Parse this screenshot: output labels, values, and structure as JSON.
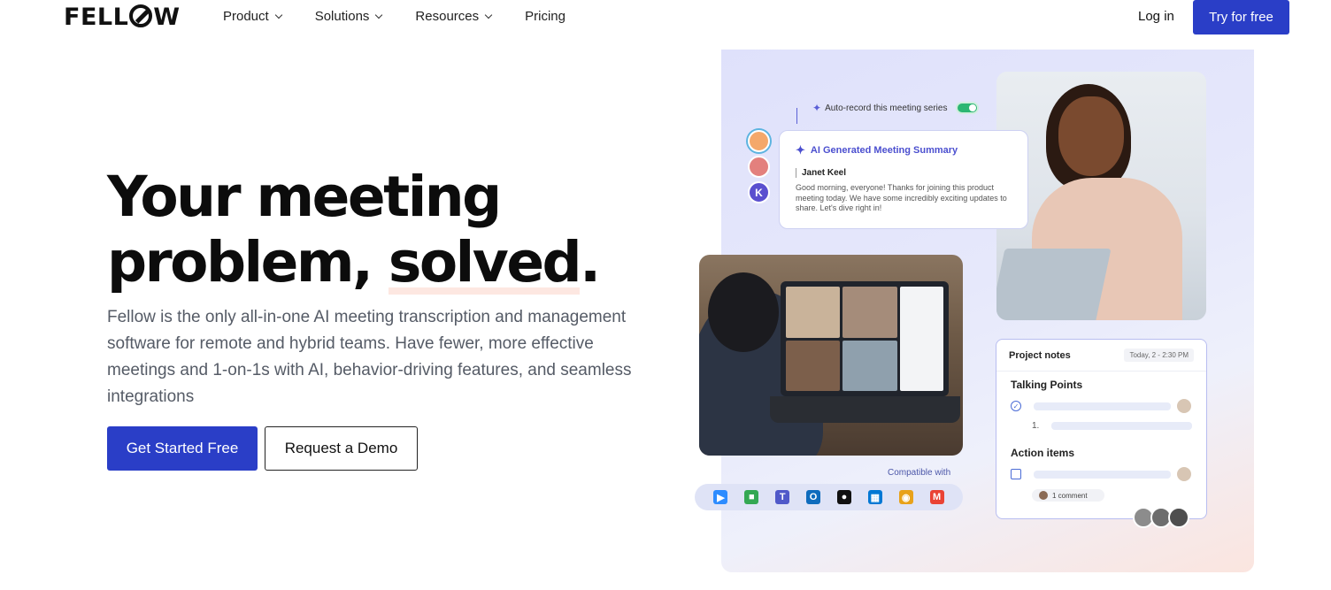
{
  "nav": {
    "logo": "FELL",
    "logo_tail": "W",
    "menu": [
      {
        "label": "Product",
        "has_dropdown": true
      },
      {
        "label": "Solutions",
        "has_dropdown": true
      },
      {
        "label": "Resources",
        "has_dropdown": true
      },
      {
        "label": "Pricing",
        "has_dropdown": false
      }
    ],
    "login": "Log in",
    "cta": "Try for free"
  },
  "hero": {
    "headline_line1": "Your meeting",
    "headline_line2_a": "problem, ",
    "headline_line2_highlight": "solved",
    "headline_line2_end": ".",
    "subtext": "Fellow is the only all-in-one AI meeting transcription and management software for remote and hybrid teams. Have fewer, more effective meetings and 1-on-1s with AI, behavior-driving features, and seamless integrations",
    "primary_button": "Get Started Free",
    "secondary_button": "Request a Demo"
  },
  "illustration": {
    "autorecord_label": "Auto-record this meeting series",
    "autorecord_on": true,
    "avatar_initial": "K",
    "ai_card": {
      "title": "AI Generated Meeting Summary",
      "speaker": "Janet Keel",
      "message": "Good morning, everyone! Thanks for joining this product meeting today. We have some incredibly exciting updates to share. Let's dive right in!"
    },
    "notes_card": {
      "title": "Project notes",
      "date": "Today, 2 - 2:30 PM",
      "section1": "Talking Points",
      "numbered_item": "1.",
      "section2": "Action items",
      "comment": "1 comment"
    },
    "compatible_label": "Compatible with",
    "integrations": [
      {
        "name": "zoom-icon",
        "glyph": "▶",
        "color": "#2d8cff"
      },
      {
        "name": "google-meet-icon",
        "glyph": "■",
        "color": "#34a853"
      },
      {
        "name": "teams-icon",
        "glyph": "T",
        "color": "#5059c9"
      },
      {
        "name": "outlook-icon",
        "glyph": "O",
        "color": "#0f6cbd"
      },
      {
        "name": "apple-icon",
        "glyph": "●",
        "color": "#111111"
      },
      {
        "name": "windows-icon",
        "glyph": "▦",
        "color": "#0078d4"
      },
      {
        "name": "chrome-icon",
        "glyph": "◉",
        "color": "#e8a21a"
      },
      {
        "name": "gmail-icon",
        "glyph": "M",
        "color": "#ea4335"
      }
    ]
  },
  "colors": {
    "brand": "#2a3ec7",
    "highlight": "#fde7e1",
    "accent_purple": "#4b4fcf"
  }
}
